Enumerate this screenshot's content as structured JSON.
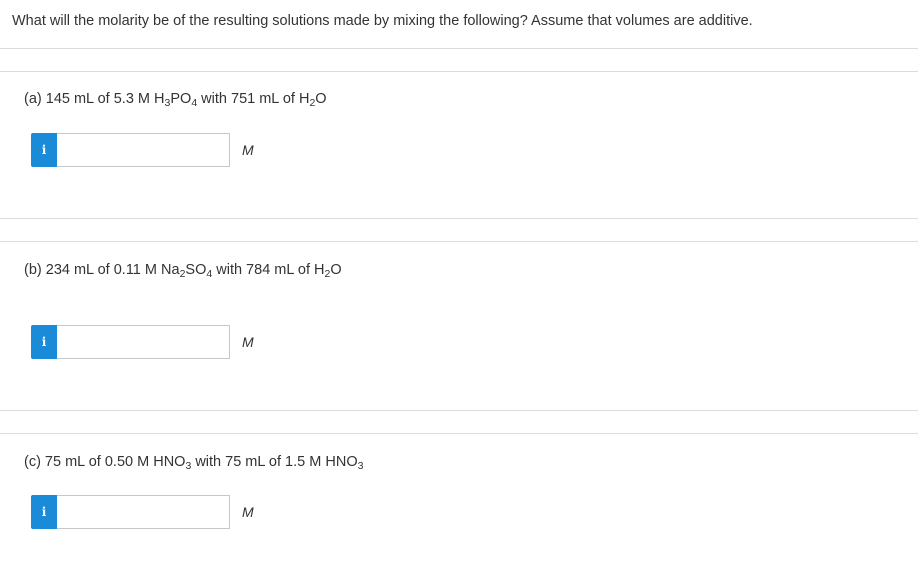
{
  "header": {
    "question_text": "What will the molarity be of the resulting solutions made by mixing the following? Assume that volumes are additive."
  },
  "parts": [
    {
      "prefix": "(a) 145  mL of 5.3 ",
      "conc_unit": "M",
      "compound_main": " H",
      "sub1": "3",
      "compound_mid": "PO",
      "sub2": "4",
      "middle": " with 751  mL of H",
      "sub3": "2",
      "suffix": "O",
      "input_value": "",
      "info_label": "i",
      "unit": "M"
    },
    {
      "prefix": "(b) 234 mL of 0.11 ",
      "conc_unit": "M",
      "compound_main": " Na",
      "sub1": "2",
      "compound_mid": "SO",
      "sub2": "4",
      "middle": " with 784 mL of H",
      "sub3": "2",
      "suffix": "O",
      "input_value": "",
      "info_label": "i",
      "unit": "M"
    },
    {
      "prefix": "(c) 75 mL of 0.50 ",
      "conc_unit": "M",
      "compound_main": " HNO",
      "sub1": "3",
      "middle": " with 75 mL of 1.5 ",
      "conc_unit2": "M",
      "compound2": " HNO",
      "sub2": "3",
      "input_value": "",
      "info_label": "i",
      "unit": "M"
    }
  ],
  "colors": {
    "info_button": "#1a8bd8",
    "divider": "#dcdcdc",
    "text": "#333333"
  },
  "icons": {
    "info": "info-icon"
  }
}
